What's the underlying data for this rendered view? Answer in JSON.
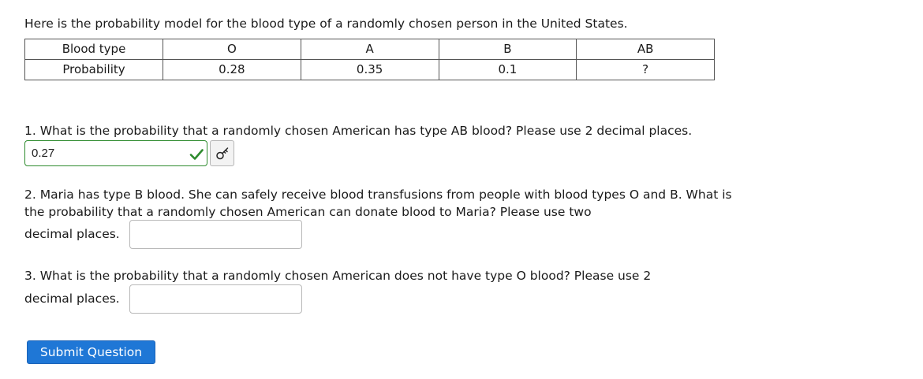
{
  "intro": "Here is the probability model for the blood type of a randomly chosen person in the United States.",
  "model_table": {
    "row_labels": [
      "Blood type",
      "Probability"
    ],
    "types": [
      "O",
      "A",
      "B",
      "AB"
    ],
    "probabilities": [
      "0.28",
      "0.35",
      "0.1",
      "?"
    ]
  },
  "q1": {
    "text": "1. What is the probability that a randomly chosen American has type AB blood? Please use 2 decimal places.",
    "answer": "0.27",
    "status_icon": "check-icon",
    "status_color": "#2e8b2e"
  },
  "q2": {
    "text": "2. Maria has type B blood. She can safely receive blood transfusions from people with blood types O and B. What is the probability that a randomly chosen American can donate blood to Maria? Please use two",
    "tail": "decimal places.",
    "value": ""
  },
  "q3": {
    "text": "3. What is the probability that a randomly chosen American does not have type O blood? Please use 2",
    "tail": "decimal places.",
    "value": ""
  },
  "submit_label": "Submit Question",
  "colors": {
    "submit_bg": "#1f77d6",
    "correct_border": "#2e8b2e"
  }
}
